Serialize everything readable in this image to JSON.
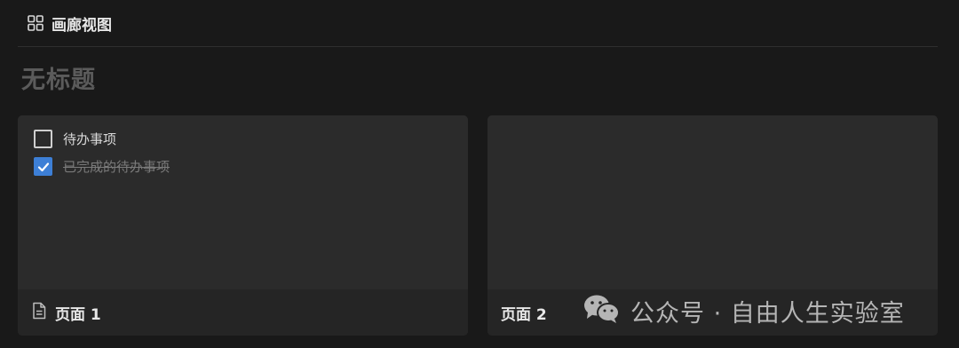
{
  "header": {
    "view_icon": "gallery-grid-icon",
    "view_label": "画廊视图"
  },
  "database": {
    "title": "无标题"
  },
  "cards": [
    {
      "title": "页面 1",
      "icon": "document-icon",
      "todos": [
        {
          "label": "待办事项",
          "checked": false
        },
        {
          "label": "已完成的待办事项",
          "checked": true
        }
      ]
    },
    {
      "title": "页面 2"
    }
  ],
  "watermark": {
    "icon": "wechat-icon",
    "text": "公众号 · 自由人生实验室"
  },
  "colors": {
    "background": "#191919",
    "card": "#2a2a2a",
    "checkbox_checked": "#3d7fd6",
    "title_muted": "#5b5b5b"
  }
}
